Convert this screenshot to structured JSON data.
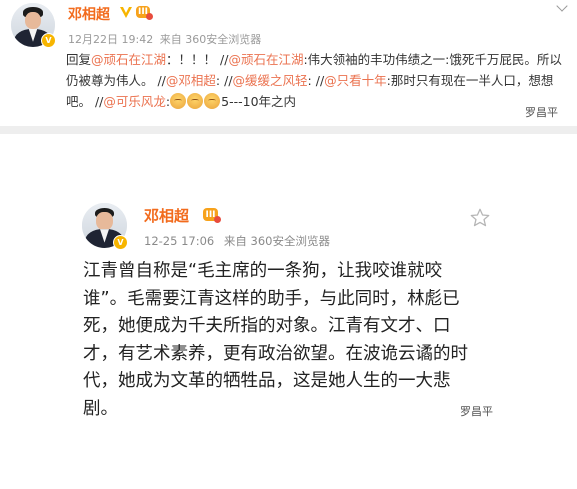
{
  "top_post": {
    "author": "邓相超",
    "verified_badge": "V",
    "level_badge": "III",
    "timestamp": "12月22日 19:42",
    "source": "来自 360安全浏览器",
    "menu_icon": "chevron-down-icon",
    "body": {
      "reply_prefix": "回复",
      "mention1": "@顽石在江湖",
      "t1": "：！！！ //",
      "mention2": "@顽石在江湖",
      "t2": ":伟大领袖的丰功伟绩之一:饿死千万屁民。所以仍被尊为伟人。 //",
      "mention3": "@邓相超",
      "t3": ": //",
      "mention4": "@缓缓之风轻",
      "t4": ": //",
      "mention5": "@只看十年",
      "t5": ":那时只有现在一半人口，想想吧。 //",
      "mention6": "@可乐风龙",
      "t6": ":",
      "t7": "5---10年之内"
    },
    "emoji_icons": [
      "clap-emoji-icon",
      "clap-emoji-icon",
      "clap-emoji-icon"
    ]
  },
  "bottom_post": {
    "author": "邓相超",
    "verified_badge": "V",
    "level_badge": "III",
    "timestamp": "12-25 17:06",
    "source": "来自 360安全浏览器",
    "favorite_icon": "star-icon",
    "body": "江青曾自称是“毛主席的一条狗，让我咬谁就咬谁”。毛需要江青这样的助手，与此同时，林彪已死，她便成为千夫所指的对象。江青有文才、口才，有艺术素养，更有政治欲望。在波诡云谲的时代，她成为文革的牺牲品，这是她人生的一大悲剧。"
  },
  "watermarks": [
    "罗昌平",
    "罗昌平"
  ],
  "colors": {
    "author_name": "#f26b1d",
    "mention_link": "#eb7350",
    "verified_badge": "#f7b500",
    "separator": "#eeeeee"
  }
}
